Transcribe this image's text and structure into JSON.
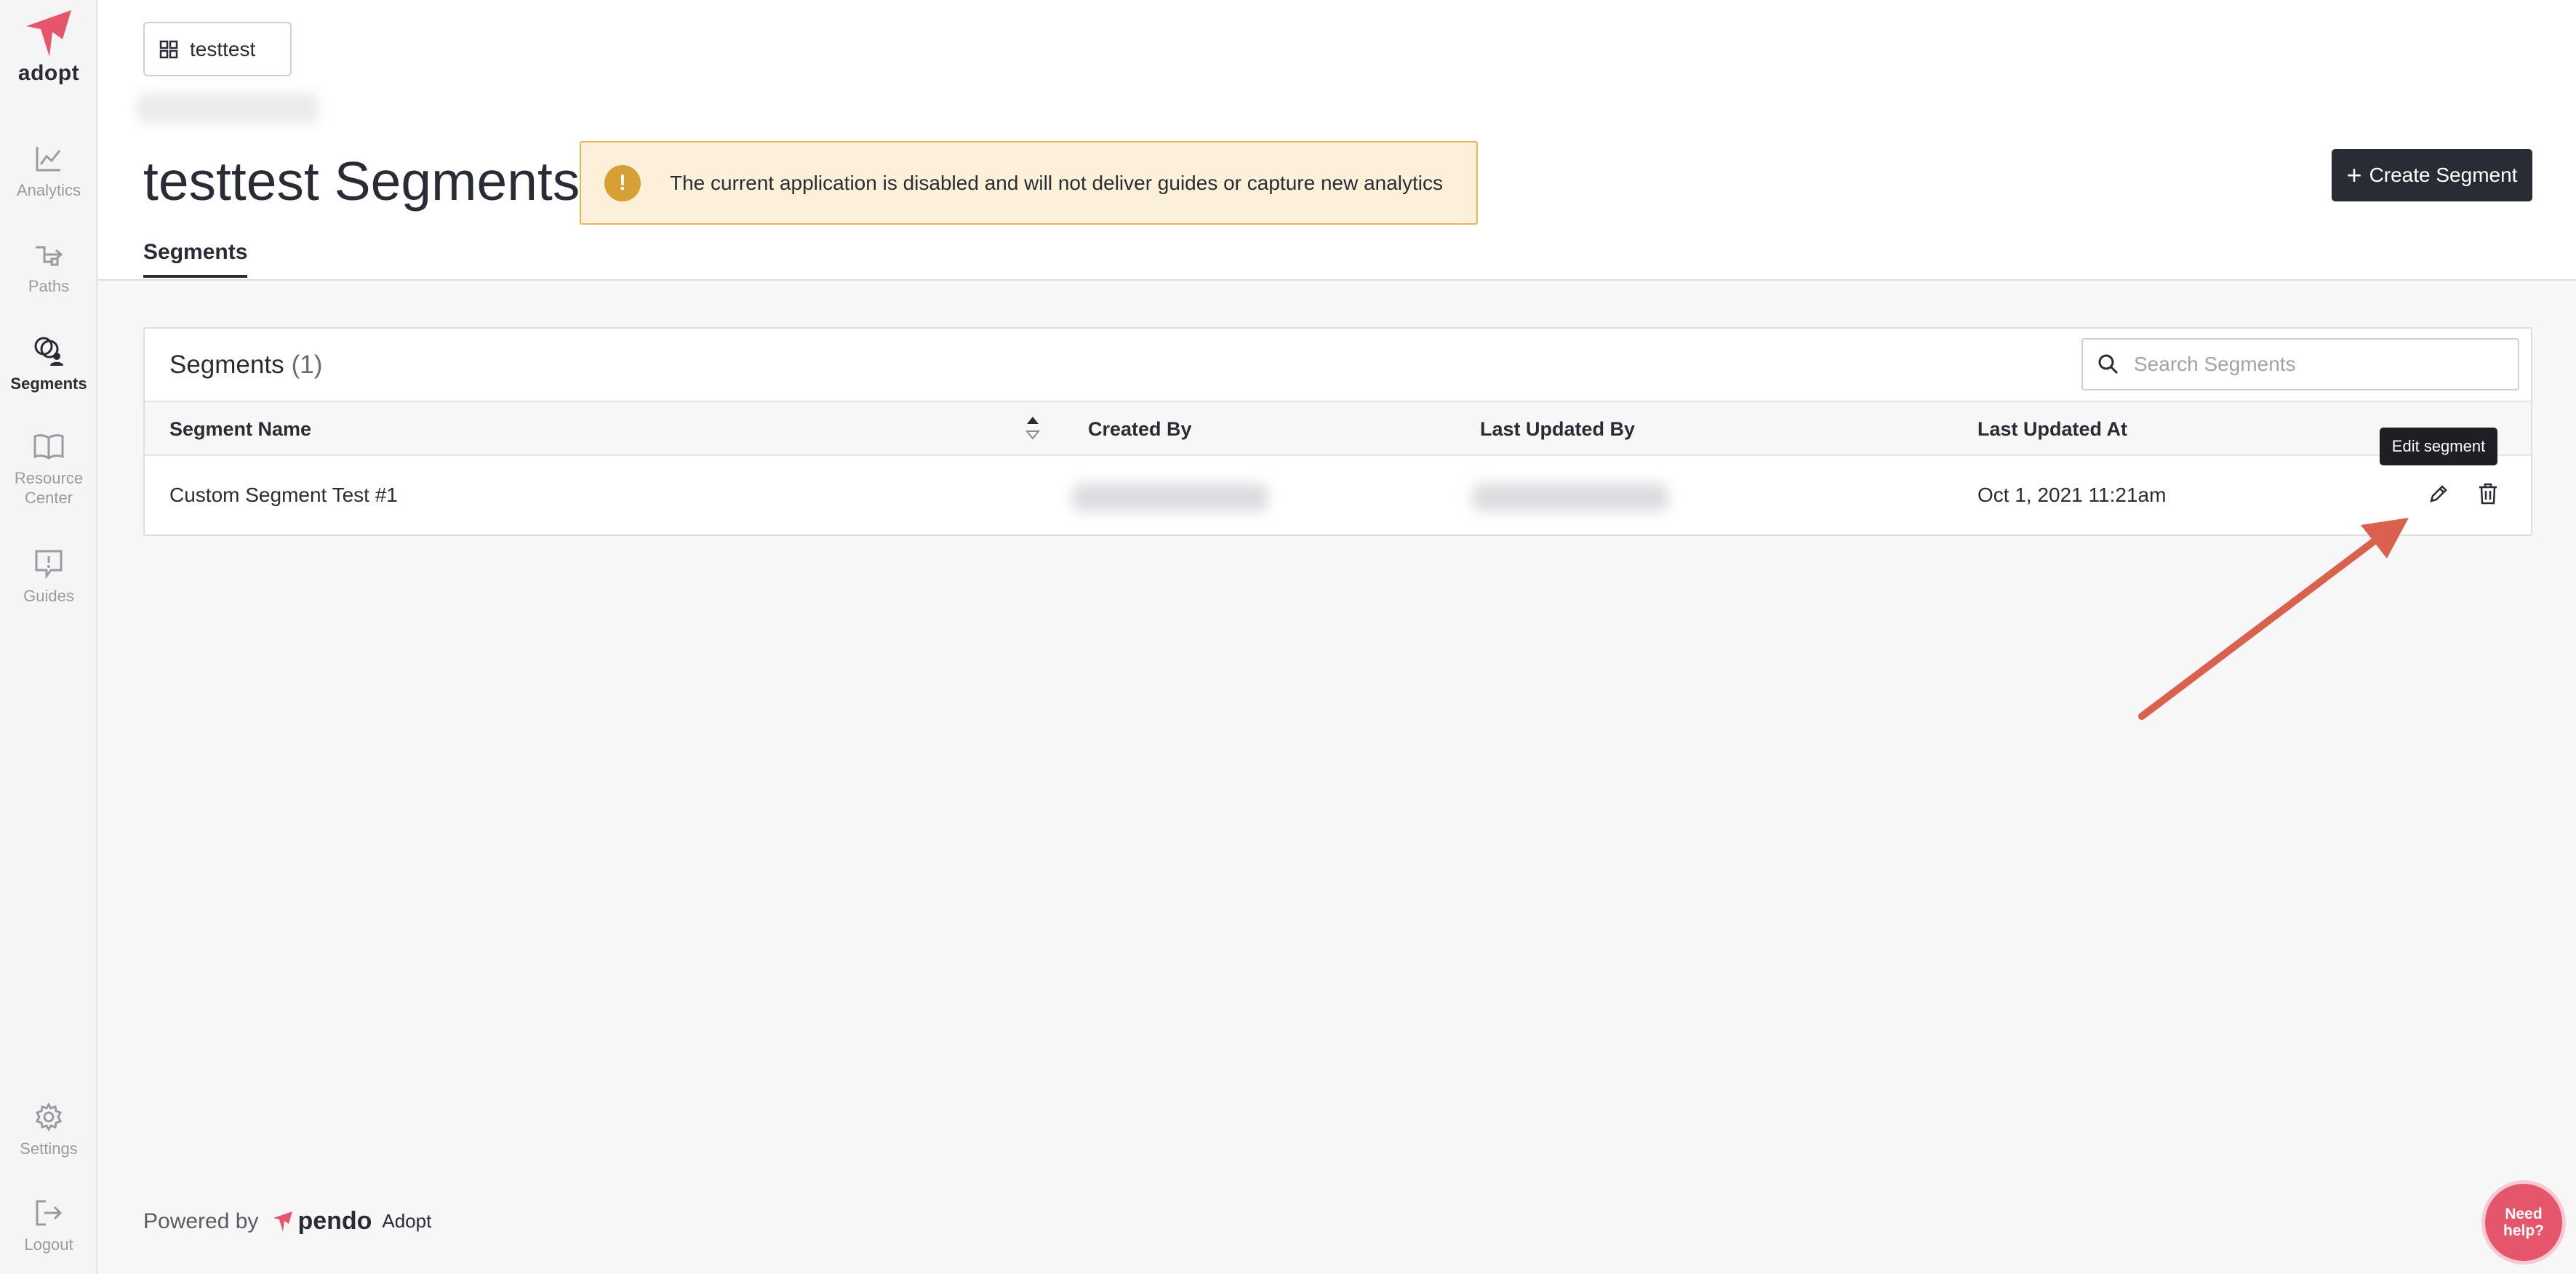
{
  "brand": {
    "logo_text": "adopt",
    "accent": "#e5566b"
  },
  "sidebar": {
    "items": [
      {
        "label": "Analytics",
        "icon": "line-chart-icon"
      },
      {
        "label": "Paths",
        "icon": "paths-icon"
      },
      {
        "label": "Segments",
        "icon": "segments-icon",
        "active": true
      },
      {
        "label": "Resource Center",
        "icon": "book-icon"
      },
      {
        "label": "Guides",
        "icon": "guide-icon"
      },
      {
        "label": "Settings",
        "icon": "gear-icon"
      },
      {
        "label": "Logout",
        "icon": "logout-icon"
      }
    ]
  },
  "header": {
    "app_selector": "testtest",
    "title": "testtest Segments",
    "warning": "The current application is disabled and will not deliver guides or capture new analytics",
    "create_button": "Create Segment",
    "tab": "Segments"
  },
  "table": {
    "title": "Segments",
    "count": "(1)",
    "search_placeholder": "Search Segments",
    "columns": [
      "Segment Name",
      "Created By",
      "Last Updated By",
      "Last Updated At"
    ],
    "rows": [
      {
        "name": "Custom Segment Test #1",
        "created_by": "",
        "last_updated_by": "",
        "last_updated_at": "Oct 1, 2021 11:21am"
      }
    ]
  },
  "tooltip": "Edit segment",
  "footer": {
    "powered_by": "Powered by",
    "brand": "pendo",
    "product": "Adopt"
  },
  "help_button": "Need help?"
}
